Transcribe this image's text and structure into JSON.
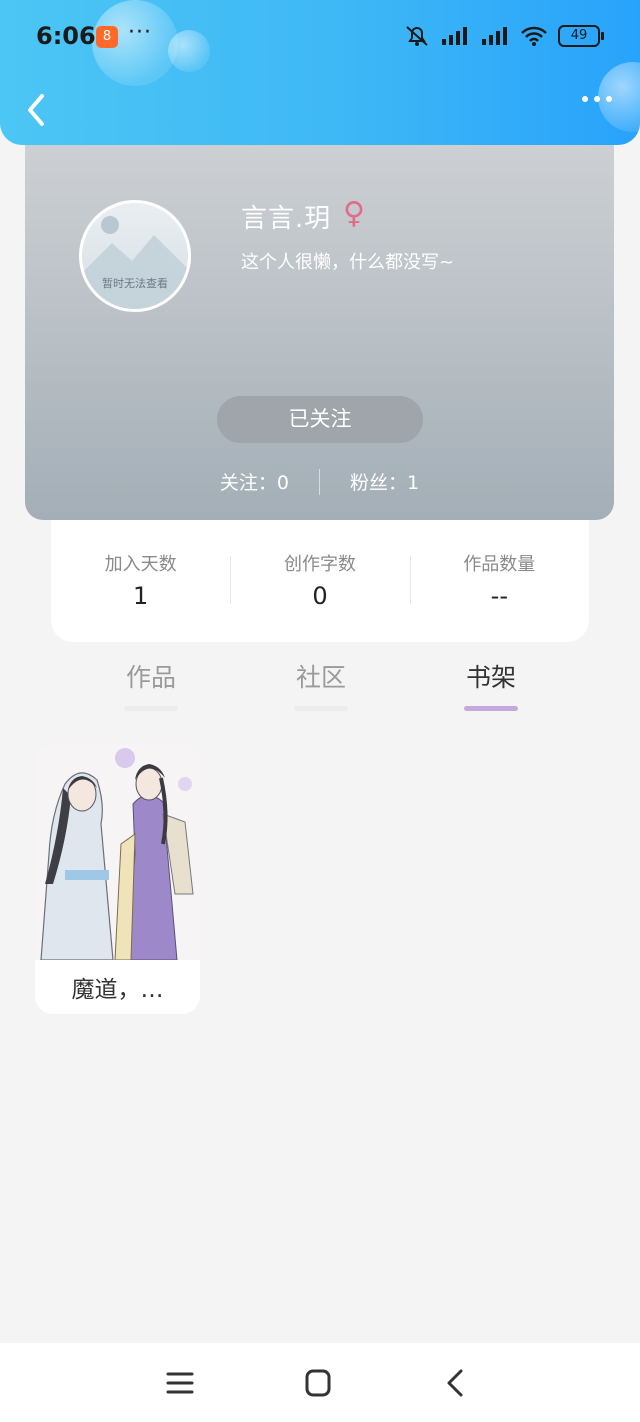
{
  "status_bar": {
    "time": "6:06",
    "app_badge_glyph": "8",
    "dots": "···",
    "battery": "49"
  },
  "profile": {
    "avatar_placeholder": "暂时无法查看",
    "username": "言言.玥",
    "gender_symbol": "♀",
    "bio": "这个人很懒，什么都没写~",
    "follow_button": "已关注",
    "following": "关注：0",
    "followers": "粉丝：1"
  },
  "stats": [
    {
      "label": "加入天数",
      "value": "1"
    },
    {
      "label": "创作字数",
      "value": "0"
    },
    {
      "label": "作品数量",
      "value": "--"
    }
  ],
  "tabs": [
    {
      "label": "作品",
      "active": false
    },
    {
      "label": "社区",
      "active": false
    },
    {
      "label": "书架",
      "active": true
    }
  ],
  "books": [
    {
      "title": "魔道，…"
    }
  ],
  "colors": {
    "header_gradient_start": "#4cc6f4",
    "header_gradient_end": "#27a3fb",
    "gender_color": "#e26b8c",
    "active_tab_underline": "#c5a9dd"
  },
  "icons": [
    "back-chevron-icon",
    "more-dots-icon",
    "mute-bell-icon",
    "signal-icon",
    "wifi-icon",
    "battery-icon",
    "menu-icon",
    "home-square-icon",
    "nav-back-icon"
  ]
}
